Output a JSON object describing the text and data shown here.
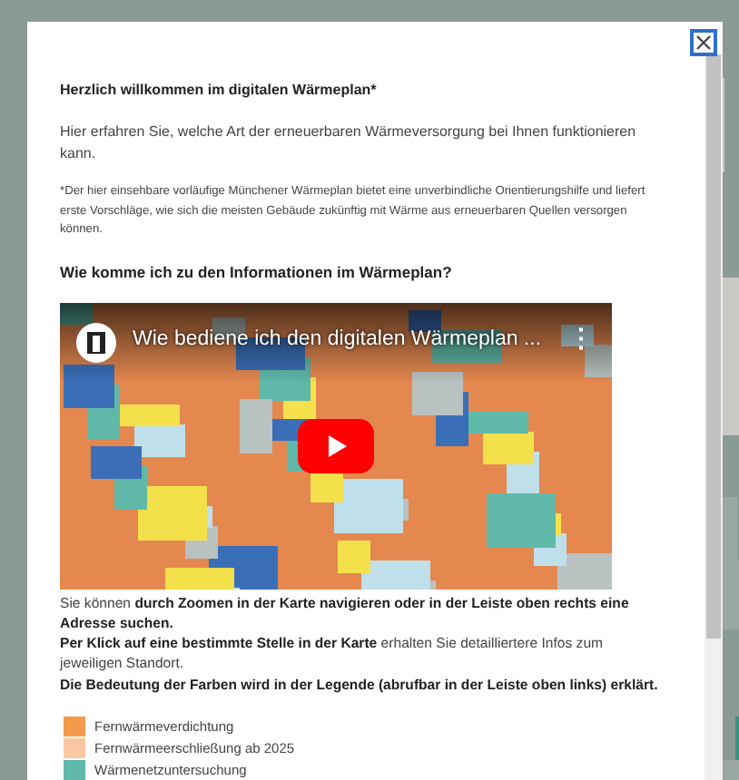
{
  "dialog": {
    "title": "Herzlich willkommen im digitalen Wärmeplan*",
    "intro": "Hier erfahren Sie, welche Art der erneuerbaren Wärmeversorgung bei Ihnen funktionieren kann.",
    "footnote": "*Der hier einsehbare vorläufige Münchener Wärmeplan bietet eine unverbindliche Orientierungshilfe und liefert erste Vorschläge, wie sich die meisten Gebäude zukünftig mit Wärme aus erneuerbaren Quellen versorgen können.",
    "heading": "Wie komme ich zu den Informationen im Wärmeplan?",
    "video": {
      "title": "Wie bediene ich den digitalen Wärmeplan ...",
      "menu": "⋮"
    },
    "instructions": [
      "Sie können **durch Zoomen in der Karte navigieren oder in der Leiste oben rechts eine Adresse suchen.**",
      "**Per Klick auf eine bestimmte Stelle in der Karte** erhalten Sie detailliertere Infos zum jeweiligen Standort.",
      "**Die Bedeutung der Farben wird in der Legende (abrufbar in der Leiste oben links) erklärt.**"
    ],
    "legend": [
      {
        "label": "Fernwärmeverdichtung",
        "color": "#f29a4a"
      },
      {
        "label": "Fernwärmeerschließung ab 2025",
        "color": "#f9c8a3"
      },
      {
        "label": "Wärmenetzuntersuchung",
        "color": "#5fb8a8"
      }
    ]
  }
}
